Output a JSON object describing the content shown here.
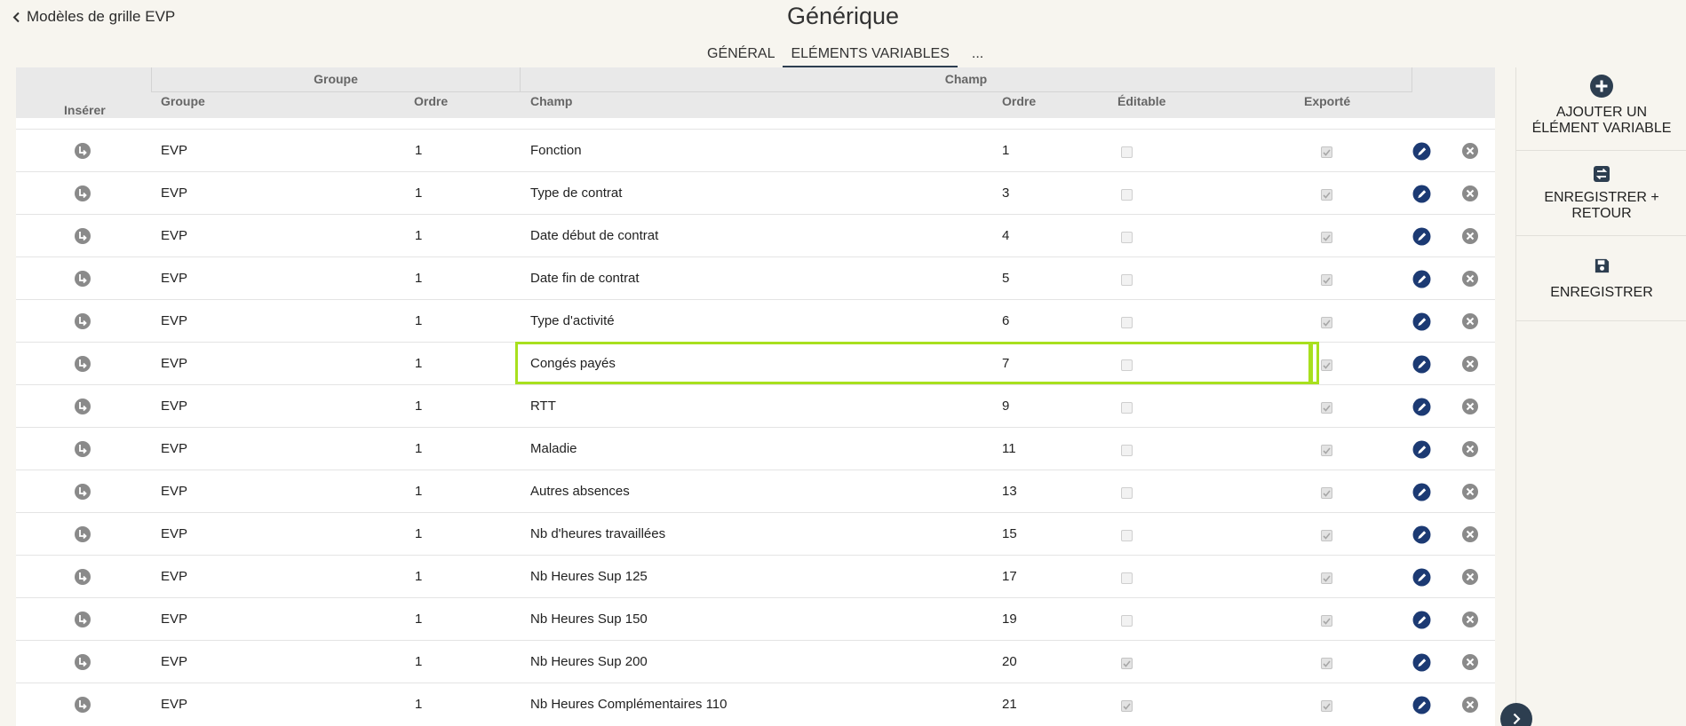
{
  "header": {
    "back_label": "Modèles de grille EVP",
    "title": "Générique",
    "tabs": [
      "GÉNÉRAL",
      "ELÉMENTS VARIABLES",
      "..."
    ],
    "active_tab": "ELÉMENTS VARIABLES"
  },
  "table": {
    "group_headers": {
      "groupe": "Groupe",
      "champ": "Champ"
    },
    "columns": {
      "inserer": "Insérer",
      "groupe": "Groupe",
      "ordre_groupe": "Ordre",
      "champ": "Champ",
      "ordre_champ": "Ordre",
      "editable": "Éditable",
      "exporte": "Exporté"
    },
    "rows": [
      {
        "groupe": "EVP",
        "ordre_groupe": "1",
        "champ": "Fonction",
        "ordre_champ": "1",
        "editable": false,
        "exporte": true
      },
      {
        "groupe": "EVP",
        "ordre_groupe": "1",
        "champ": "Type de contrat",
        "ordre_champ": "3",
        "editable": false,
        "exporte": true
      },
      {
        "groupe": "EVP",
        "ordre_groupe": "1",
        "champ": "Date début de contrat",
        "ordre_champ": "4",
        "editable": false,
        "exporte": true
      },
      {
        "groupe": "EVP",
        "ordre_groupe": "1",
        "champ": "Date fin de contrat",
        "ordre_champ": "5",
        "editable": false,
        "exporte": true
      },
      {
        "groupe": "EVP",
        "ordre_groupe": "1",
        "champ": "Type d'activité",
        "ordre_champ": "6",
        "editable": false,
        "exporte": true
      },
      {
        "groupe": "EVP",
        "ordre_groupe": "1",
        "champ": "Congés payés",
        "ordre_champ": "7",
        "editable": false,
        "exporte": true,
        "highlighted": true
      },
      {
        "groupe": "EVP",
        "ordre_groupe": "1",
        "champ": "RTT",
        "ordre_champ": "9",
        "editable": false,
        "exporte": true
      },
      {
        "groupe": "EVP",
        "ordre_groupe": "1",
        "champ": "Maladie",
        "ordre_champ": "11",
        "editable": false,
        "exporte": true
      },
      {
        "groupe": "EVP",
        "ordre_groupe": "1",
        "champ": "Autres absences",
        "ordre_champ": "13",
        "editable": false,
        "exporte": true
      },
      {
        "groupe": "EVP",
        "ordre_groupe": "1",
        "champ": "Nb d'heures travaillées",
        "ordre_champ": "15",
        "editable": false,
        "exporte": true
      },
      {
        "groupe": "EVP",
        "ordre_groupe": "1",
        "champ": "Nb Heures Sup 125",
        "ordre_champ": "17",
        "editable": false,
        "exporte": true
      },
      {
        "groupe": "EVP",
        "ordre_groupe": "1",
        "champ": "Nb Heures Sup 150",
        "ordre_champ": "19",
        "editable": false,
        "exporte": true
      },
      {
        "groupe": "EVP",
        "ordre_groupe": "1",
        "champ": "Nb Heures Sup 200",
        "ordre_champ": "20",
        "editable": true,
        "exporte": true
      },
      {
        "groupe": "EVP",
        "ordre_groupe": "1",
        "champ": "Nb Heures Complémentaires 110",
        "ordre_champ": "21",
        "editable": true,
        "exporte": true
      }
    ],
    "row_icons": {
      "insert": "insert-below-icon",
      "edit": "edit-icon",
      "delete": "delete-icon"
    }
  },
  "sidebar": {
    "add_label": "AJOUTER UN ÉLÉMENT VARIABLE",
    "save_return_label": "ENREGISTRER + RETOUR",
    "save_label": "ENREGISTRER",
    "icons": [
      "plus-circle-icon",
      "save-return-icon",
      "save-icon"
    ]
  },
  "colors": {
    "background": "#f7f5ef",
    "header_bg": "#e9e9e9",
    "accent": "#2d3e50",
    "highlight": "#a8e01e",
    "edit_icon": "#1c3a73",
    "muted_icon": "#8a8a8a"
  }
}
